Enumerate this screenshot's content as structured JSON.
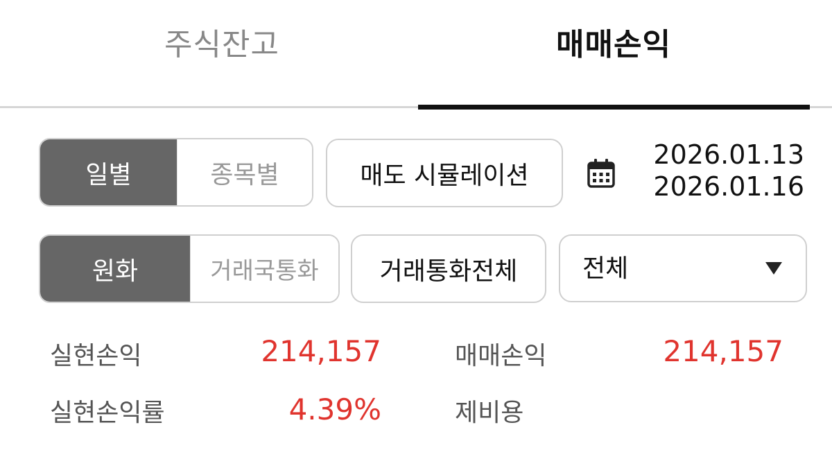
{
  "tabs": {
    "items": [
      {
        "label": "주식잔고",
        "active": false
      },
      {
        "label": "매매손익",
        "active": true
      }
    ]
  },
  "filters": {
    "period_toggle": {
      "options": [
        "일별",
        "종목별"
      ],
      "selected": "일별"
    },
    "sell_simulation_label": "매도 시뮬레이션",
    "date_range": {
      "start": "2026.01.13",
      "end": "2026.01.16"
    },
    "currency_toggle": {
      "options": [
        "원화",
        "거래국통화"
      ],
      "selected": "원화"
    },
    "all_currency_label": "거래통화전체",
    "dropdown": {
      "selected": "전체"
    }
  },
  "summary": {
    "realized_pl_label": "실현손익",
    "realized_pl_value": "214,157",
    "trade_pl_label": "매매손익",
    "trade_pl_value": "214,157",
    "realized_rate_label": "실현손익률",
    "realized_rate_value": "4.39%",
    "fees_label": "제비용"
  },
  "colors": {
    "accent_red": "#e0342e",
    "active_segment": "#666666",
    "tab_indicator": "#111111"
  },
  "icons": {
    "calendar": "calendar-icon",
    "dropdown": "caret-down-icon"
  }
}
